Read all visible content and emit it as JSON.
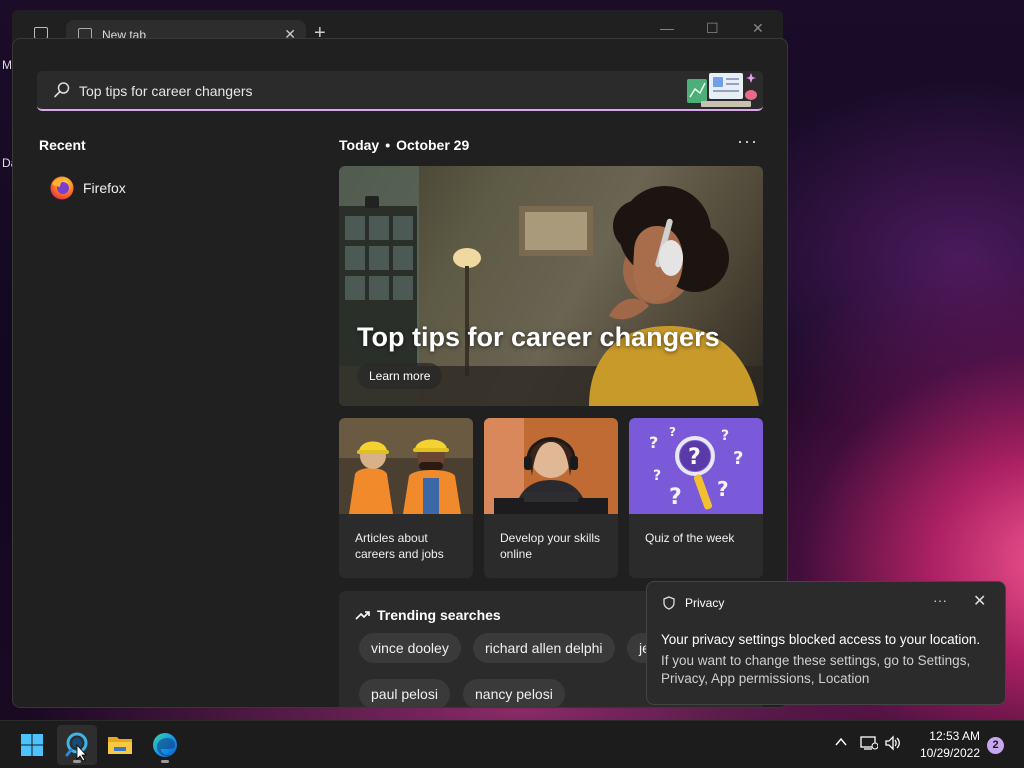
{
  "desktop": {
    "label_m": "M",
    "label_d": "Da"
  },
  "browser": {
    "tab_title": "New tab",
    "close_glyph": "✕",
    "new_tab_glyph": "+"
  },
  "widgets": {
    "search": {
      "value": "Top tips for career changers"
    },
    "recent": {
      "heading": "Recent",
      "items": [
        {
          "label": "Firefox",
          "icon": "firefox-icon"
        }
      ]
    },
    "feed": {
      "heading_day": "Today",
      "heading_date": "October 29",
      "more_glyph": "···",
      "hero": {
        "title": "Top tips for career changers",
        "button": "Learn more"
      },
      "cards": [
        {
          "label": "Articles about careers and jobs"
        },
        {
          "label": "Develop your skills online"
        },
        {
          "label": "Quiz of the week"
        }
      ],
      "trending": {
        "heading": "Trending searches",
        "chips": [
          "vince dooley",
          "richard allen delphi",
          "je",
          "paul pelosi",
          "nancy pelosi"
        ]
      }
    }
  },
  "toast": {
    "title": "Privacy",
    "more_glyph": "···",
    "close_glyph": "✕",
    "message": "Your privacy settings blocked access to your location.",
    "detail": "If you want to change these settings, go to Settings, Privacy, App permissions, Location"
  },
  "taskbar": {
    "time": "12:53 AM",
    "date": "10/29/2022",
    "notification_count": "2",
    "accent_color": "#c7a7f0"
  }
}
